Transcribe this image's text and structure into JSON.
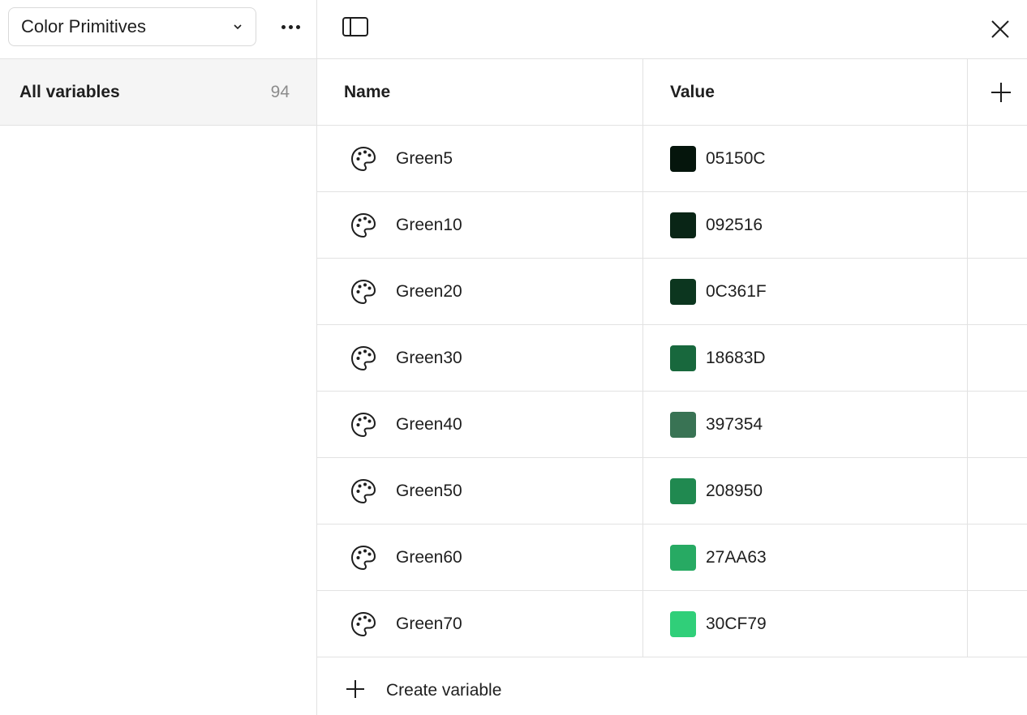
{
  "sidebar": {
    "collection_label": "Color Primitives",
    "groups": [
      {
        "label": "All variables",
        "count": "94"
      }
    ]
  },
  "table": {
    "headers": {
      "name": "Name",
      "value": "Value"
    },
    "rows": [
      {
        "name": "Green5",
        "hex": "05150C",
        "color": "#05150C"
      },
      {
        "name": "Green10",
        "hex": "092516",
        "color": "#092516"
      },
      {
        "name": "Green20",
        "hex": "0C361F",
        "color": "#0C361F"
      },
      {
        "name": "Green30",
        "hex": "18683D",
        "color": "#18683D"
      },
      {
        "name": "Green40",
        "hex": "397354",
        "color": "#397354"
      },
      {
        "name": "Green50",
        "hex": "208950",
        "color": "#208950"
      },
      {
        "name": "Green60",
        "hex": "27AA63",
        "color": "#27AA63"
      },
      {
        "name": "Green70",
        "hex": "30CF79",
        "color": "#30CF79"
      }
    ],
    "create_label": "Create variable"
  },
  "colors": {
    "border": "#e2e2e2",
    "selected_bg": "#f5f5f5",
    "text": "#1e1e1e",
    "muted": "#8c8c8c"
  }
}
